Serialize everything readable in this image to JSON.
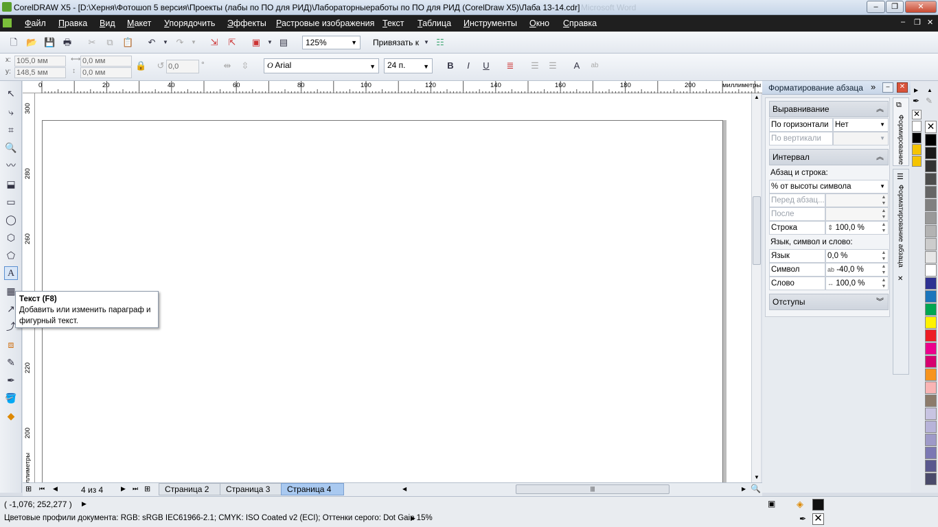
{
  "window": {
    "title": "CorelDRAW X5 - [D:\\Херня\\Фотошоп 5 версия\\Проекты (лабы по ПО для РИД)\\Лабораторныеработы по ПО для РИД (CorelDraw X5)\\Лаба 13-14.cdr]",
    "ghost_title": "Microsoft Word"
  },
  "menu": {
    "items": [
      "Файл",
      "Правка",
      "Вид",
      "Макет",
      "Упорядочить",
      "Эффекты",
      "Растровые изображения",
      "Текст",
      "Таблица",
      "Инструменты",
      "Окно",
      "Справка"
    ]
  },
  "standard": {
    "zoom": "125%",
    "snap_label": "Привязать к"
  },
  "property": {
    "x": "105,0 мм",
    "y": "148,5 мм",
    "w": "0,0 мм",
    "h": "0,0 мм",
    "angle": "0,0",
    "font": "Arial",
    "size": "24 п.",
    "deg": "°"
  },
  "ruler": {
    "unit": "миллиметры",
    "h_ticks": [
      "0",
      "20",
      "40",
      "60",
      "80",
      "100",
      "120",
      "140",
      "160",
      "180",
      "200"
    ],
    "v_ticks": [
      "300",
      "280",
      "260",
      "240",
      "220",
      "200"
    ],
    "v_unit": "миллиметры"
  },
  "tooltip": {
    "title": "Текст (F8)",
    "body": "Добавить или изменить параграф и фигурный текст."
  },
  "docker": {
    "title": "Форматирование абзаца",
    "align_header": "Выравнивание",
    "horiz_label": "По горизонтали",
    "horiz_value": "Нет",
    "vert_label": "По вертикали",
    "interval_header": "Интервал",
    "para_line_label": "Абзац и строка:",
    "spacing_mode": "% от высоты символа",
    "before_label": "Перед абзац...",
    "after_label": "После абзацев",
    "line_label": "Строка",
    "line_value": "100,0 %",
    "lang_section": "Язык, символ и слово:",
    "lang_label": "Язык",
    "lang_value": "0,0 %",
    "char_label": "Символ",
    "char_value": "-40,0 %",
    "word_label": "Слово",
    "word_value": "100,0 %",
    "indent_header": "Отступы",
    "tab1": "Формирование",
    "tab2": "Форматирование абзаца"
  },
  "pages": {
    "counter": "4 из 4",
    "tabs": [
      "Страница 2",
      "Страница 3",
      "Страница 4"
    ],
    "active": "Страница 4"
  },
  "status": {
    "coords": "( -1,076; 252,277 )",
    "profiles": "Цветовые профили документа: RGB: sRGB IEC61966-2.1; CMYK: ISO Coated v2 (ECI); Оттенки серого: Dot Gain 15%"
  },
  "palette": {
    "colors": [
      "#000000",
      "#1a1a1a",
      "#333333",
      "#4d4d4d",
      "#666666",
      "#808080",
      "#999999",
      "#b3b3b3",
      "#cccccc",
      "#e6e6e6",
      "#ffffff",
      "#2e3192",
      "#1b75bc",
      "#00a651",
      "#fff200",
      "#ed1c24",
      "#ec008c",
      "#d6006f",
      "#f7941d",
      "#f9b4b4",
      "#8c7b6b",
      "#c8c4e2",
      "#b7b3d9",
      "#9e9ac8",
      "#7b78b3",
      "#5a588e",
      "#4a4a6a"
    ]
  }
}
